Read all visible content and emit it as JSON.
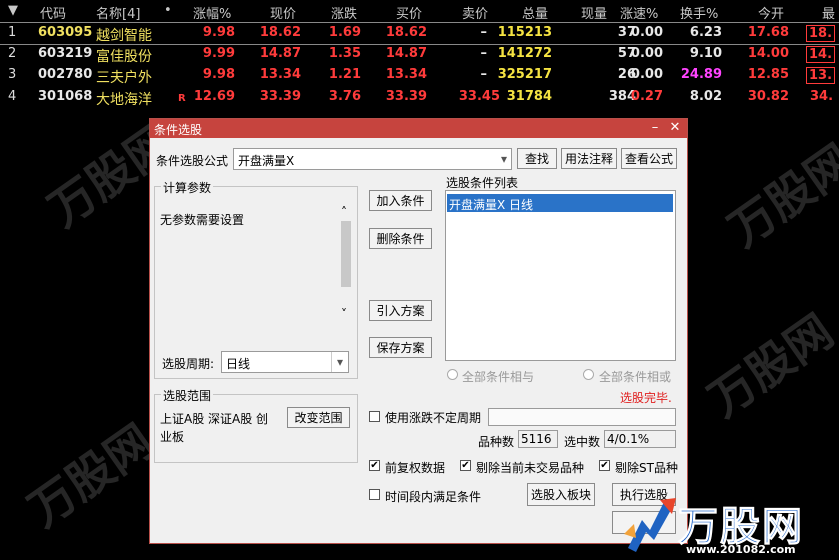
{
  "header": {
    "sort_icon": "▼",
    "code": "代码",
    "name": "名称[4]",
    "dot": "•",
    "pct": "涨幅%",
    "price": "现价",
    "change": "涨跌",
    "bid": "买价",
    "ask": "卖价",
    "volume": "总量",
    "cur_vol": "现量",
    "speed": "涨速%",
    "turnover": "换手%",
    "open": "今开",
    "high": "最"
  },
  "rows": [
    {
      "idx": "1",
      "code": "603095",
      "name": "越剑智能",
      "flag": "",
      "pct": "9.98",
      "price": "18.62",
      "change": "1.69",
      "bid": "18.62",
      "ask": "–",
      "volume": "115213",
      "cur_vol": "37",
      "speed": "0.00",
      "turnover": "6.23",
      "open": "17.68",
      "high": "18."
    },
    {
      "idx": "2",
      "code": "603219",
      "name": "富佳股份",
      "flag": "",
      "pct": "9.99",
      "price": "14.87",
      "change": "1.35",
      "bid": "14.87",
      "ask": "–",
      "volume": "141272",
      "cur_vol": "57",
      "speed": "0.00",
      "turnover": "9.10",
      "open": "14.00",
      "high": "14."
    },
    {
      "idx": "3",
      "code": "002780",
      "name": "三夫户外",
      "flag": "",
      "pct": "9.98",
      "price": "13.34",
      "change": "1.21",
      "bid": "13.34",
      "ask": "–",
      "volume": "325217",
      "cur_vol": "26",
      "speed": "0.00",
      "turnover": "24.89",
      "open": "12.85",
      "high": "13."
    },
    {
      "idx": "4",
      "code": "301068",
      "name": "大地海洋",
      "flag": "R",
      "pct": "12.69",
      "price": "33.39",
      "change": "3.76",
      "bid": "33.39",
      "ask": "33.45",
      "volume": "31784",
      "cur_vol": "384",
      "speed": "0.27",
      "turnover": "8.02",
      "open": "30.82",
      "high": "34."
    }
  ],
  "dialog": {
    "title": "条件选股",
    "minimize": "–",
    "close": "✕",
    "formula_label": "条件选股公式",
    "formula_value": "开盘满量X",
    "dropdown_arrow": "▾",
    "find_btn": "查找",
    "usage_btn": "用法注释",
    "view_btn": "查看公式",
    "params_group": "计算参数",
    "params_text": "无参数需要设置",
    "scroll_up": "˄",
    "scroll_down": "˅",
    "period_label": "选股周期:",
    "period_value": "日线",
    "add_btn": "加入条件",
    "del_btn": "删除条件",
    "import_btn": "引入方案",
    "save_btn": "保存方案",
    "list_label": "选股条件列表",
    "list_items": [
      "开盘满量X  日线"
    ],
    "radio_and": "全部条件相与",
    "radio_or": "全部条件相或",
    "status": "选股完毕.",
    "range_group": "选股范围",
    "range_text": "上证A股 深证A股 创业板",
    "change_range_btn": "改变范围",
    "use_period_label": "使用涨跌不定周期",
    "count_label": "品种数",
    "count_value": "5116",
    "selected_label": "选中数",
    "selected_value": "4/0.1%",
    "chk_adjust": "前复权数据",
    "chk_exclude_untraded": "剔除当前未交易品种",
    "chk_exclude_st": "剔除ST品种",
    "chk_time_range": "时间段内满足条件",
    "to_board_btn": "选股入板块",
    "exec_btn": "执行选股"
  },
  "logo": {
    "text": "万股网",
    "url": "www.201082.com"
  },
  "watermark": "万股网",
  "colors": {
    "up_red": "#ff3b3b",
    "stock_yellow": "#f5e342",
    "title_red": "#c6443e",
    "list_blue": "#2a73c8",
    "status_red": "#e02020",
    "turnover_magenta": "#ff44ff"
  }
}
